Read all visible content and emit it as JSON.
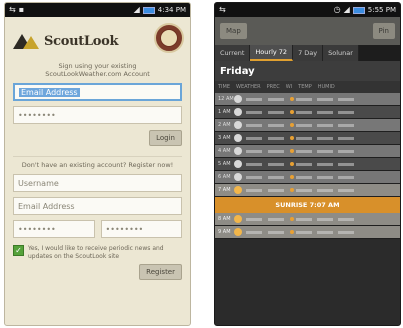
{
  "left": {
    "status": {
      "time": "4:34 PM"
    },
    "brand": "ScoutLook",
    "subtext_line1": "Sign using your existing",
    "subtext_line2": "ScoutLookWeather.com Account",
    "login": {
      "email_placeholder": "Email Address",
      "password_value": "••••••••",
      "button_label": "Login"
    },
    "register_prompt": "Don't have an existing account? Register now!",
    "register": {
      "username_placeholder": "Username",
      "email_placeholder": "Email Address",
      "password_value": "••••••••",
      "confirm_value": "••••••••",
      "checkbox_label": "Yes, I would like to receive periodic news and updates on the ScoutLook site",
      "button_label": "Register"
    }
  },
  "right": {
    "status": {
      "time": "5:55 PM"
    },
    "menu": {
      "left_label": "Map",
      "right_label": "Pin"
    },
    "tabs": [
      "Current",
      "Hourly 72",
      "7 Day",
      "Solunar"
    ],
    "active_tab": "Hourly 72",
    "day": "Friday",
    "columns": [
      "TIME",
      "WEATHER",
      "PREC",
      "WI",
      "TEMP",
      "HUMID"
    ],
    "rows": [
      {
        "time": "12 AM",
        "type": "night"
      },
      {
        "time": "1 AM",
        "type": "night"
      },
      {
        "time": "2 AM",
        "type": "night"
      },
      {
        "time": "3 AM",
        "type": "night"
      },
      {
        "time": "4 AM",
        "type": "night"
      },
      {
        "time": "5 AM",
        "type": "night"
      },
      {
        "time": "6 AM",
        "type": "night"
      },
      {
        "time": "7 AM",
        "type": "day"
      }
    ],
    "sunrise": "SUNRISE 7:07 AM",
    "rows_after": [
      {
        "time": "8 AM",
        "type": "day"
      },
      {
        "time": "9 AM",
        "type": "day"
      }
    ]
  },
  "colors": {
    "sunrise_band": "#d8902a",
    "accent_blue": "#6aa5d8",
    "check_green": "#55a23a"
  }
}
